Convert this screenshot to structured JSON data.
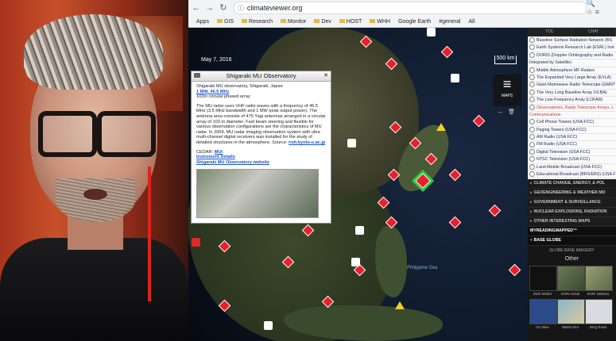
{
  "browser": {
    "url": "climateviewer.org",
    "bookmarks": [
      "Apps",
      "GIS",
      "Research",
      "Monitor",
      "Dev",
      "HOST",
      "WHH",
      "Google Earth",
      "#general",
      "All"
    ]
  },
  "map": {
    "date": "May 7, 2016",
    "scale": "500 km",
    "labels": [
      "Philippine Sea"
    ],
    "maps_button": "MAPS"
  },
  "popup": {
    "title": "Shigaraki MU Observatory",
    "heading_line": "Shigaraki MU observatory, Shigaraki, Japan",
    "power_link": "1 MW, 46.5 MHz",
    "antenna_line": "103m circular phased array",
    "description": "The MU radar uses VHF radio waves with a frequency of 46.5 MHz (3.5 MHz bandwidth and 1 MW peak output power). The antenna area consists of 475 Yagi antennas arranged in a circular array of 103 m diameter. Fast beam steering and flexible for various observation configurations are the characteristics of MU radar. In 2004, MU radar imaging observation system with ultra multi-channel digital receivers was installed for the study of detailed structures in the atmosphere. Source:",
    "source_link": "rish.kyoto-u.ac.jp",
    "cedar_label": "CEDAR:",
    "cedar_link": "MUI",
    "instrument_link": "Instrument Details",
    "website_link": "Shigaraki MU Observatory website"
  },
  "panel": {
    "tabs": [
      "TOC",
      "CHAT"
    ],
    "layers": [
      {
        "label": "Baseline Surface Radiation Network (BS",
        "highlight": false
      },
      {
        "label": "Earth Systems Research Lab (ESRL) Inst",
        "highlight": false
      },
      {
        "label": "DORIS (Doppler Orbitography and Radio",
        "highlight": false
      },
      {
        "label": "Integrated by Satellite)",
        "highlight": false
      },
      {
        "label": "Middle Atmosphere MF Radars",
        "highlight": false
      },
      {
        "label": "The Expanded Very Large Array (EVLA)",
        "highlight": false
      },
      {
        "label": "Giant Metrewave Radio Telescope (GMRT",
        "highlight": false
      },
      {
        "label": "The Very Long Baseline Array (VLBA)",
        "highlight": false
      },
      {
        "label": "The Low-Frequency Array (LOFAR)",
        "highlight": false
      },
      {
        "label": "Observatories, Radio Telescope Arrays, L",
        "highlight": true
      },
      {
        "label": "Communications",
        "highlight": true
      },
      {
        "label": "Cell Phone Towers (USA FCC)",
        "highlight": false
      },
      {
        "label": "Paging Towers (USA FCC)",
        "highlight": false
      },
      {
        "label": "AM Radio (USA FCC)",
        "highlight": false
      },
      {
        "label": "FM Radio (USA FCC)",
        "highlight": false
      },
      {
        "label": "Digital Television (USA FCC)",
        "highlight": false
      },
      {
        "label": "NTSC Television (USA FCC)",
        "highlight": false
      },
      {
        "label": "Land Mobile Broadcast (USA FCC)",
        "highlight": false
      },
      {
        "label": "Educational Broadcast (BRS/EBS) (USA F",
        "highlight": false
      }
    ],
    "categories": [
      "CLIMATE CHANGE, ENERGY, & POL",
      "GEOENGINEERING & WEATHER MO",
      "GOVERNMENT & SURVEILLANCE",
      "NUCLEAR EXPLOSIONS, RADIATION",
      "OTHER INTERESTING MAPS",
      "MYREADINGMAPPED™",
      "BASE GLOBE"
    ],
    "globe_header": "GLOBE BASE IMAGERY",
    "globe_other": "Other",
    "thumbnails": [
      "Dark Matter",
      "ESRI Aerial",
      "ESRI NatGeo",
      "OV Blue",
      "Watercolor",
      "Bing Road"
    ]
  }
}
